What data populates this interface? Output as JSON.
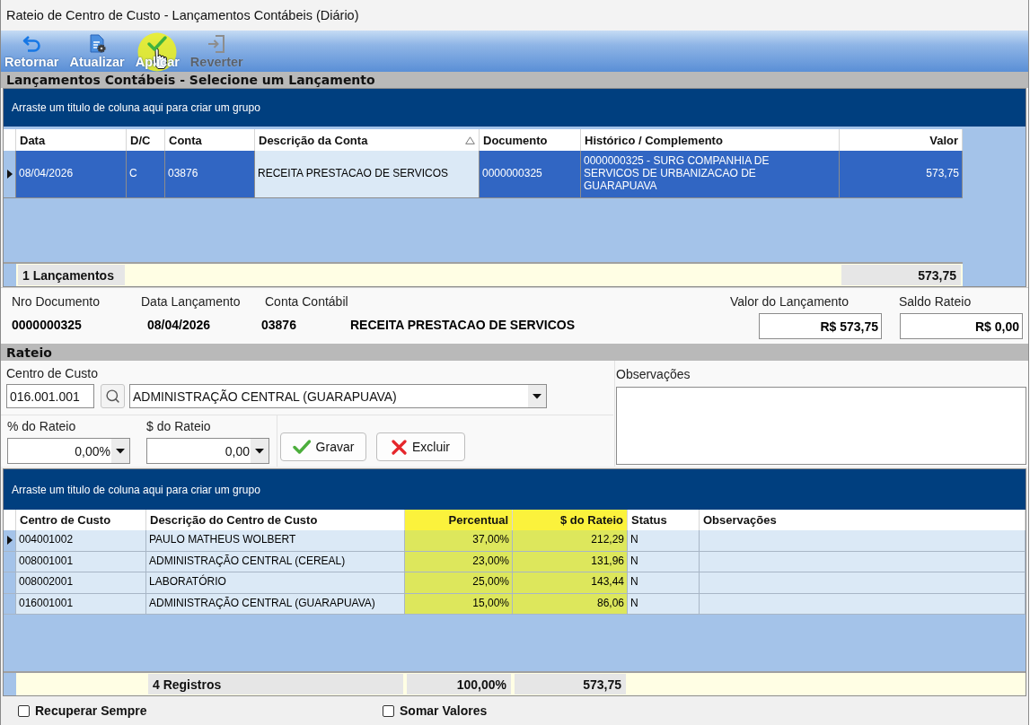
{
  "window": {
    "title": "Rateio de Centro de Custo - Lançamentos Contábeis (Diário)"
  },
  "toolbar": [
    {
      "kind": "return",
      "label": "Retornar",
      "disabled": false,
      "highlighted": false
    },
    {
      "kind": "refresh",
      "label": "Atualizar",
      "disabled": false,
      "highlighted": false
    },
    {
      "kind": "apply",
      "label": "Aplicar",
      "disabled": false,
      "highlighted": true
    },
    {
      "kind": "revert",
      "label": "Reverter",
      "disabled": true,
      "highlighted": false
    }
  ],
  "entries_section": {
    "title": "Lançamentos Contábeis - Selecione um Lançamento"
  },
  "entries": {
    "group_hint": "Arraste um titulo de coluna aqui para criar um grupo",
    "columns": [
      {
        "label": "Data",
        "sorted": false
      },
      {
        "label": "D/C",
        "sorted": false
      },
      {
        "label": "Conta",
        "sorted": false
      },
      {
        "label": "Descrição da Conta",
        "sorted": true
      },
      {
        "label": "Documento",
        "sorted": false
      },
      {
        "label": "Histórico / Complemento",
        "sorted": false
      },
      {
        "label": "Valor",
        "sorted": false
      }
    ],
    "rows": [
      {
        "selected": true,
        "current": true,
        "cells": [
          {
            "text": "08/04/2026",
            "focused": false
          },
          {
            "text": "C",
            "focused": false
          },
          {
            "text": "03876",
            "focused": false
          },
          {
            "text": "RECEITA PRESTACAO DE SERVICOS",
            "focused": true
          },
          {
            "text": "0000000325",
            "focused": false
          },
          {
            "text": "0000000325 - SURG COMPANHIA DE SERVICOS DE URBANIZACAO DE GUARAPUAVA",
            "focused": false
          },
          {
            "text": "573,75",
            "focused": false
          }
        ]
      }
    ],
    "footer": {
      "count": "1 Lançamentos",
      "total": "573,75"
    }
  },
  "document": {
    "fields": [
      {
        "label": "Nro Documento",
        "value": "0000000325"
      },
      {
        "label": "Data Lançamento",
        "value": "08/04/2026"
      },
      {
        "label": "Conta Contábil",
        "value": "03876"
      }
    ],
    "account_name": "RECEITA PRESTACAO DE SERVICOS",
    "amounts": [
      {
        "label": "Valor do Lançamento",
        "value": "R$ 573,75"
      },
      {
        "label": "Saldo Rateio",
        "value": "R$ 0,00"
      }
    ]
  },
  "rateio": {
    "title": "Rateio",
    "cost_center": {
      "label": "Centro de Custo",
      "code": "016.001.001",
      "name": "ADMINISTRAÇÃO CENTRAL (GUARAPUAVA)"
    },
    "percent": {
      "label": "% do Rateio",
      "value": "0,00%"
    },
    "amount": {
      "label": "$ do Rateio",
      "value": "0,00"
    },
    "buttons": [
      {
        "kind": "save",
        "label": "Gravar"
      },
      {
        "kind": "delete",
        "label": "Excluir"
      }
    ],
    "notes": {
      "label": "Observações"
    }
  },
  "allocations": {
    "group_hint": "Arraste um titulo de coluna aqui para criar um grupo",
    "columns": [
      {
        "label": "Centro de Custo",
        "highlighted": false
      },
      {
        "label": "Descrição do Centro de Custo",
        "highlighted": false
      },
      {
        "label": "Percentual",
        "highlighted": true
      },
      {
        "label": "$ do Rateio",
        "highlighted": true
      },
      {
        "label": "Status",
        "highlighted": false
      },
      {
        "label": "Observações",
        "highlighted": false
      }
    ],
    "rows": [
      {
        "current": true,
        "cells": [
          "004001002",
          "PAULO MATHEUS WOLBERT",
          "37,00%",
          "212,29",
          "N"
        ]
      },
      {
        "current": false,
        "cells": [
          "008001001",
          "ADMINISTRAÇÃO CENTRAL (CEREAL)",
          "23,00%",
          "131,96",
          "N"
        ]
      },
      {
        "current": false,
        "cells": [
          "008002001",
          "LABORATÓRIO",
          "25,00%",
          "143,44",
          "N"
        ]
      },
      {
        "current": false,
        "cells": [
          "016001001",
          "ADMINISTRAÇÃO CENTRAL (GUARAPUAVA)",
          "15,00%",
          "86,06",
          "N"
        ]
      }
    ],
    "footer": {
      "count": "4 Registros",
      "percent_total": "100,00%",
      "amount_total": "573,75"
    }
  },
  "options": [
    {
      "label": "Recuperar Sempre",
      "checked": false
    },
    {
      "label": "Somar Valores",
      "checked": false
    }
  ]
}
